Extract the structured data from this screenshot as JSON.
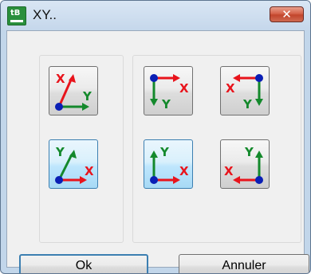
{
  "window": {
    "title": "XY..",
    "close_symbol": "✕",
    "app_icon": "app-icon"
  },
  "axes": {
    "x_label": "X",
    "y_label": "Y",
    "x_color": "#e8141c",
    "y_color": "#14892c",
    "origin_color": "#0a1fb5",
    "options": [
      {
        "id": "x-up-y-right",
        "selected": false
      },
      {
        "id": "x-right-y-down",
        "selected": false
      },
      {
        "id": "x-left-y-down",
        "selected": false
      },
      {
        "id": "x-right-y-up",
        "selected": true
      },
      {
        "id": "x-right-y-up-mirrored",
        "selected": true
      },
      {
        "id": "x-left-y-up",
        "selected": false
      }
    ]
  },
  "buttons": {
    "ok": "Ok",
    "cancel": "Annuler"
  }
}
